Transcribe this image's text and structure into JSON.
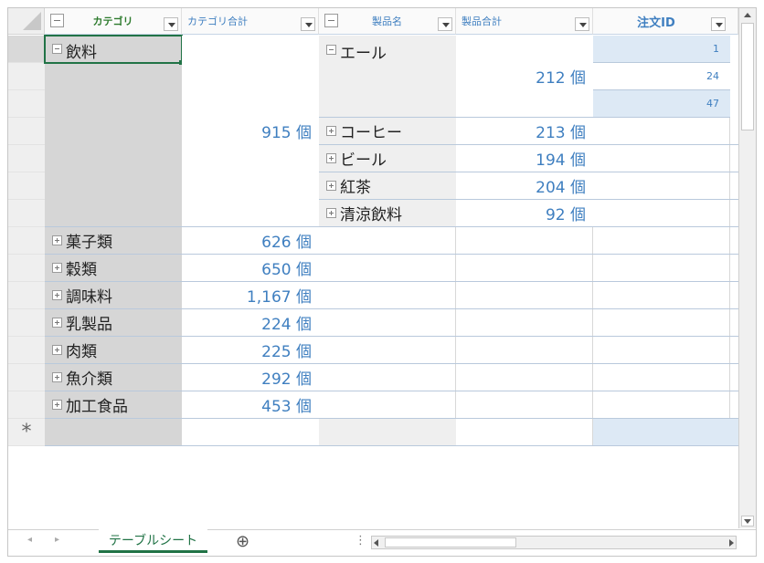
{
  "columns": {
    "category": "カテゴリ",
    "category_total": "カテゴリ合計",
    "product": "製品名",
    "product_total": "製品合計",
    "order_id": "注文ID"
  },
  "category_rows": [
    {
      "name": "飲料",
      "total": "915 個"
    },
    {
      "name": "菓子類",
      "total": "626 個"
    },
    {
      "name": "穀類",
      "total": "650 個"
    },
    {
      "name": "調味料",
      "total": "1,167 個"
    },
    {
      "name": "乳製品",
      "total": "224 個"
    },
    {
      "name": "肉類",
      "total": "225 個"
    },
    {
      "name": "魚介類",
      "total": "292 個"
    },
    {
      "name": "加工食品",
      "total": "453 個"
    }
  ],
  "product_rows": [
    {
      "name": "エール",
      "total": "212 個"
    },
    {
      "name": "コーヒー",
      "total": "213 個"
    },
    {
      "name": "ビール",
      "total": "194 個"
    },
    {
      "name": "紅茶",
      "total": "204 個"
    },
    {
      "name": "清涼飲料",
      "total": "92 個"
    }
  ],
  "order_ids": [
    "1",
    "24",
    "47"
  ],
  "new_row_marker": "*",
  "sheet_tab": "テーブルシート",
  "add_sheet_glyph": "⊕",
  "nav_prev": "◂",
  "nav_next": "▸",
  "split_glyph": "⋮",
  "colors": {
    "accent": "#3f7fc0",
    "group_header": "#2c7a2c",
    "selected_border": "#217346"
  }
}
